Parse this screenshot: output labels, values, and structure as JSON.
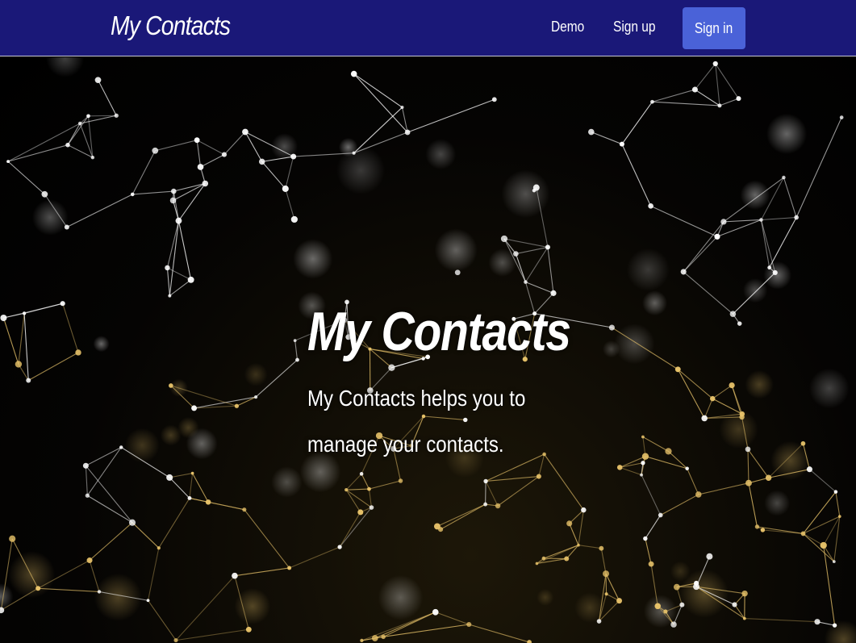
{
  "navbar": {
    "brand": "My Contacts",
    "links": [
      {
        "label": "Demo"
      },
      {
        "label": "Sign up"
      }
    ],
    "signin_label": "Sign in",
    "background_color": "#1a1878",
    "button_color": "#4a62d8"
  },
  "hero": {
    "title": "My Contacts",
    "subtitle": "My Contacts helps you to manage your contacts.",
    "background_image": "network-graph-illustration",
    "network_colors": [
      "#ffffff",
      "#e8c36a"
    ]
  }
}
